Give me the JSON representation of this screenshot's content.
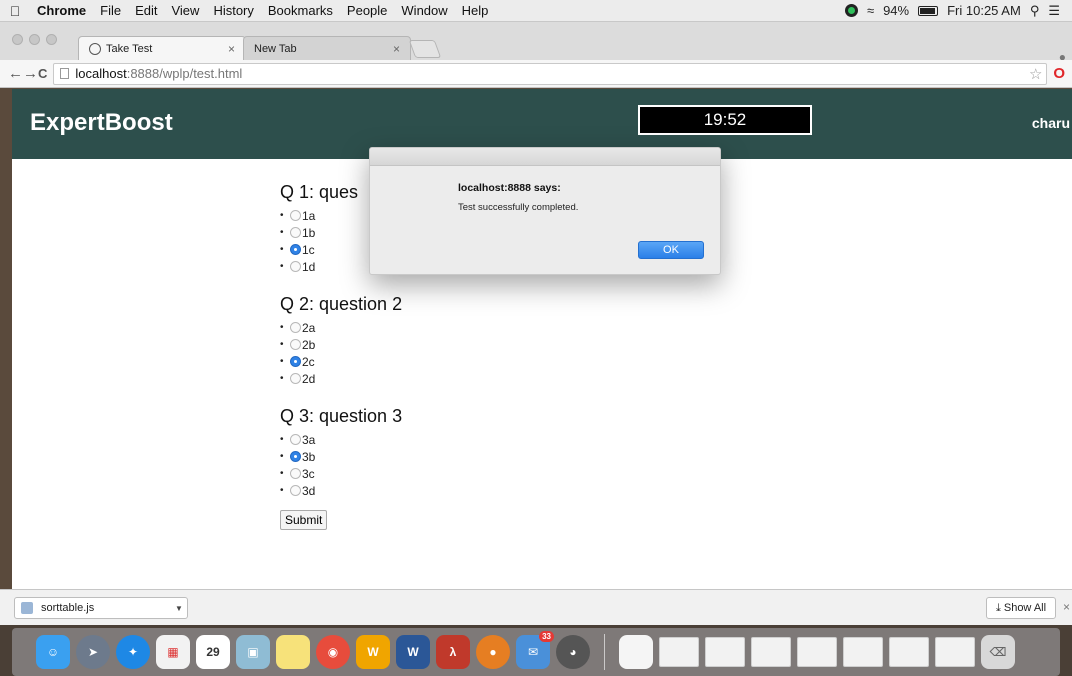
{
  "menubar": {
    "app": "Chrome",
    "items": [
      "File",
      "Edit",
      "View",
      "History",
      "Bookmarks",
      "People",
      "Window",
      "Help"
    ],
    "battery": "94%",
    "clock": "Fri 10:25 AM"
  },
  "tabs": [
    {
      "label": "Take Test"
    },
    {
      "label": "New Tab"
    }
  ],
  "addressbar": {
    "host": "localhost",
    "path": ":8888/wplp/test.html"
  },
  "page": {
    "brand": "ExpertBoost",
    "timer": "19:52",
    "user": "charu",
    "submit_label": "Submit",
    "questions": [
      {
        "title": "Q 1: question 1",
        "visible_title": "Q 1: ques",
        "options": [
          "1a",
          "1b",
          "1c",
          "1d"
        ],
        "selected": "1c"
      },
      {
        "title": "Q 2: question 2",
        "visible_title": "Q 2: question 2",
        "options": [
          "2a",
          "2b",
          "2c",
          "2d"
        ],
        "selected": "2c"
      },
      {
        "title": "Q 3: question 3",
        "visible_title": "Q 3: question 3",
        "options": [
          "3a",
          "3b",
          "3c",
          "3d"
        ],
        "selected": "3b"
      }
    ]
  },
  "dialog": {
    "title": "localhost:8888 says:",
    "message": "Test successfully completed.",
    "ok_label": "OK"
  },
  "downloads": {
    "file": "sorttable.js",
    "show_all": "Show All"
  },
  "dock": {
    "calendar_day": "29",
    "mail_badge": "33"
  },
  "colors": {
    "header_bg": "#2d4f4c",
    "accent_blue": "#2f82e6"
  }
}
